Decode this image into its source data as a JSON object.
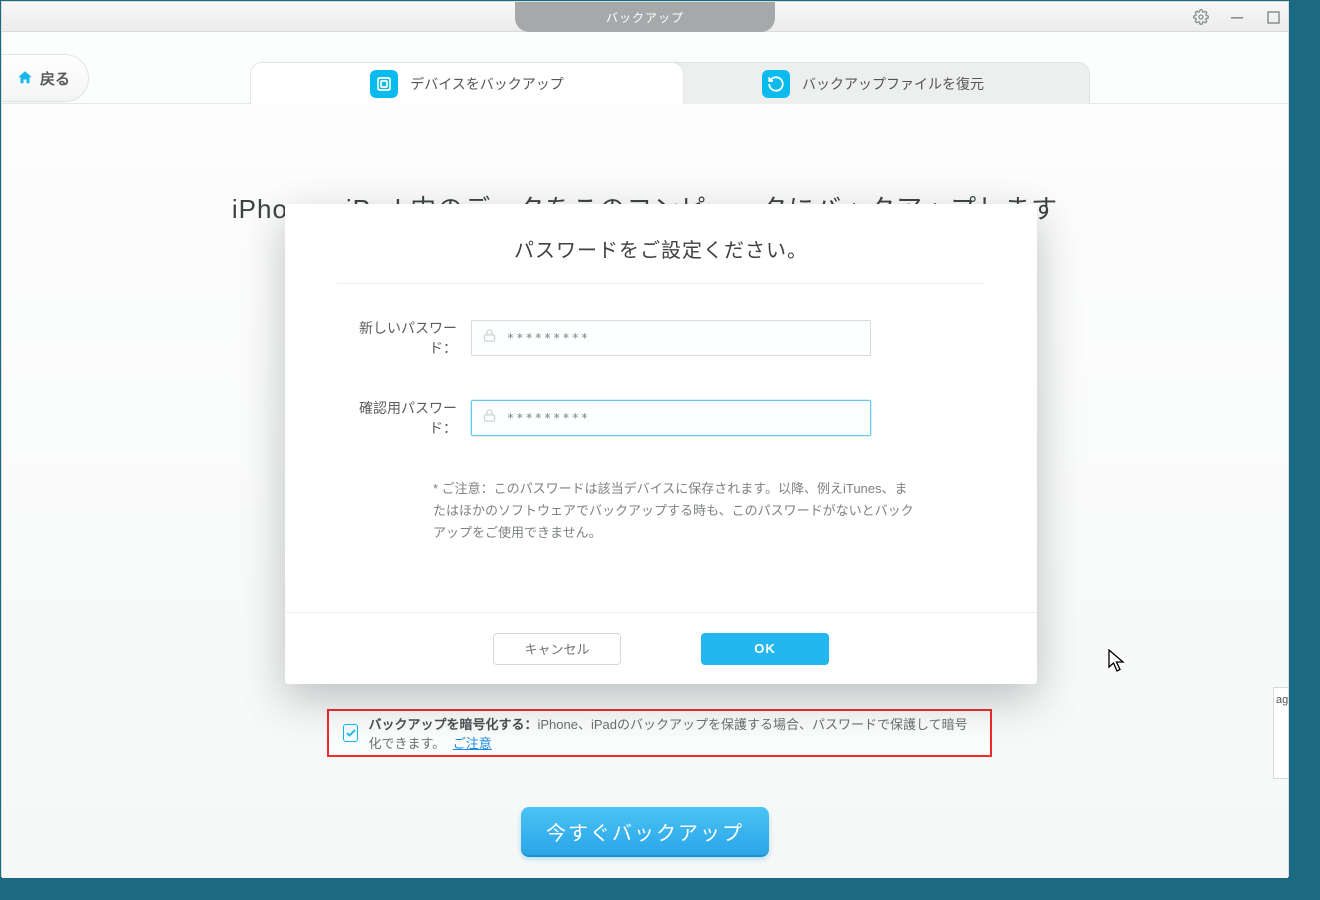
{
  "window": {
    "title": "バックアップ"
  },
  "nav": {
    "back_label": "戻る"
  },
  "tabs": {
    "backup_label": "デバイスをバックアップ",
    "restore_label": "バックアップファイルを復元"
  },
  "headline": "iPhone、iPad 内のデータをこのコンピュータにバックアップします",
  "modal": {
    "title": "パスワードをご設定ください。",
    "new_pw_label": "新しいパスワード：",
    "confirm_pw_label": "確認用パスワード：",
    "new_pw_value": "*********",
    "confirm_pw_value": "*********",
    "note": "* ご注意：このパスワードは該当デバイスに保存されます。以降、例えiTunes、またはほかのソフトウェアでバックアップする時も、このパスワードがないとバックアップをご使用できません。",
    "cancel_label": "キャンセル",
    "ok_label": "OK"
  },
  "encrypt": {
    "bold": "バックアップを暗号化する：",
    "desc": "iPhone、iPadのバックアップを保護する場合、パスワードで保護して暗号化できます。",
    "link": "ご注意"
  },
  "primary_button": "今すぐバックアップ",
  "clip": "ag"
}
